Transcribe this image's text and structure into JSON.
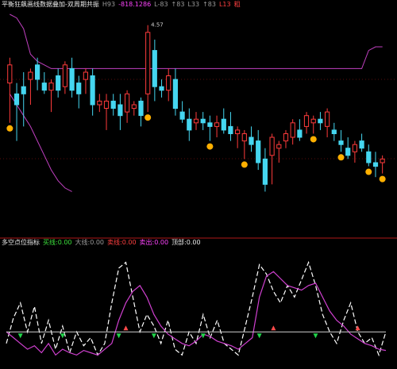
{
  "colors": {
    "background": "#000000",
    "up_candle": "#ff3b3b",
    "down_candle": "#45d6f0",
    "band": "#c040c0",
    "signal_marker": "#ffb000",
    "grid": "#b01818",
    "indicator_fast": "#ffffff",
    "indicator_slow": "#d040d0",
    "zero_line": "#d0d0d0",
    "buy_arrow": "#21d44a",
    "sell_arrow": "#ff4a4a"
  },
  "header": {
    "title": "平衡狂飙画线数据叠加-双周期共振",
    "items": [
      {
        "text": "H93",
        "color": "gray"
      },
      {
        "text": "-818.1286",
        "color": "mag"
      },
      {
        "text": "L-83",
        "color": "gray"
      },
      {
        "text": "↑83",
        "color": "gray"
      },
      {
        "text": "L33",
        "color": "gray"
      },
      {
        "text": "↑83",
        "color": "gray"
      },
      {
        "text": "L13",
        "color": "red"
      },
      {
        "text": "粗",
        "color": "red"
      }
    ]
  },
  "indicator_header": {
    "title": "多空点位指标",
    "items": [
      {
        "text": "买线:0.00",
        "color": "green"
      },
      {
        "text": "大线:0.00",
        "color": "gray"
      },
      {
        "text": "卖线:0.00",
        "color": "red"
      },
      {
        "text": "卖出:0.00",
        "color": "mag"
      },
      {
        "text": "顶部:0.00",
        "color": "white"
      }
    ]
  },
  "price_annotation": "4.57",
  "chart_data": [
    {
      "type": "candlestick",
      "title": "平衡狂飙画线数据叠加-双周期共振",
      "ylim": [
        0,
        100
      ],
      "candles": [
        {
          "o": 62,
          "h": 76,
          "l": 40,
          "c": 72
        },
        {
          "o": 56,
          "h": 62,
          "l": 30,
          "c": 50
        },
        {
          "o": 60,
          "h": 68,
          "l": 38,
          "c": 56
        },
        {
          "o": 64,
          "h": 70,
          "l": 50,
          "c": 68
        },
        {
          "o": 72,
          "h": 76,
          "l": 58,
          "c": 64
        },
        {
          "o": 62,
          "h": 68,
          "l": 56,
          "c": 58
        },
        {
          "o": 58,
          "h": 64,
          "l": 46,
          "c": 62
        },
        {
          "o": 66,
          "h": 70,
          "l": 54,
          "c": 58
        },
        {
          "o": 60,
          "h": 74,
          "l": 56,
          "c": 72
        },
        {
          "o": 70,
          "h": 76,
          "l": 54,
          "c": 58
        },
        {
          "o": 62,
          "h": 66,
          "l": 48,
          "c": 56
        },
        {
          "o": 64,
          "h": 70,
          "l": 56,
          "c": 68
        },
        {
          "o": 66,
          "h": 70,
          "l": 44,
          "c": 50
        },
        {
          "o": 50,
          "h": 56,
          "l": 46,
          "c": 52
        },
        {
          "o": 48,
          "h": 56,
          "l": 36,
          "c": 52
        },
        {
          "o": 52,
          "h": 56,
          "l": 44,
          "c": 48
        },
        {
          "o": 50,
          "h": 56,
          "l": 36,
          "c": 44
        },
        {
          "o": 46,
          "h": 58,
          "l": 40,
          "c": 56
        },
        {
          "o": 48,
          "h": 52,
          "l": 44,
          "c": 50
        },
        {
          "o": 52,
          "h": 54,
          "l": 38,
          "c": 44
        },
        {
          "o": 56,
          "h": 94,
          "l": 46,
          "c": 90
        },
        {
          "o": 80,
          "h": 86,
          "l": 52,
          "c": 60
        },
        {
          "o": 60,
          "h": 64,
          "l": 54,
          "c": 58
        },
        {
          "o": 58,
          "h": 70,
          "l": 52,
          "c": 66
        },
        {
          "o": 64,
          "h": 70,
          "l": 44,
          "c": 48
        },
        {
          "o": 46,
          "h": 52,
          "l": 40,
          "c": 42
        },
        {
          "o": 42,
          "h": 48,
          "l": 30,
          "c": 36
        },
        {
          "o": 40,
          "h": 46,
          "l": 36,
          "c": 42
        },
        {
          "o": 42,
          "h": 46,
          "l": 36,
          "c": 40
        },
        {
          "o": 40,
          "h": 44,
          "l": 30,
          "c": 38
        },
        {
          "o": 38,
          "h": 44,
          "l": 32,
          "c": 40
        },
        {
          "o": 42,
          "h": 48,
          "l": 34,
          "c": 36
        },
        {
          "o": 38,
          "h": 46,
          "l": 30,
          "c": 34
        },
        {
          "o": 34,
          "h": 38,
          "l": 26,
          "c": 36
        },
        {
          "o": 30,
          "h": 36,
          "l": 20,
          "c": 34
        },
        {
          "o": 32,
          "h": 38,
          "l": 24,
          "c": 28
        },
        {
          "o": 30,
          "h": 36,
          "l": 14,
          "c": 18
        },
        {
          "o": 20,
          "h": 26,
          "l": 2,
          "c": 6
        },
        {
          "o": 22,
          "h": 34,
          "l": 6,
          "c": 32
        },
        {
          "o": 26,
          "h": 30,
          "l": 18,
          "c": 28
        },
        {
          "o": 30,
          "h": 36,
          "l": 26,
          "c": 34
        },
        {
          "o": 32,
          "h": 42,
          "l": 28,
          "c": 40
        },
        {
          "o": 36,
          "h": 42,
          "l": 30,
          "c": 32
        },
        {
          "o": 38,
          "h": 46,
          "l": 34,
          "c": 44
        },
        {
          "o": 40,
          "h": 44,
          "l": 34,
          "c": 42
        },
        {
          "o": 42,
          "h": 46,
          "l": 36,
          "c": 40
        },
        {
          "o": 38,
          "h": 48,
          "l": 32,
          "c": 46
        },
        {
          "o": 36,
          "h": 40,
          "l": 30,
          "c": 34
        },
        {
          "o": 30,
          "h": 36,
          "l": 24,
          "c": 28
        },
        {
          "o": 26,
          "h": 32,
          "l": 20,
          "c": 22
        },
        {
          "o": 24,
          "h": 30,
          "l": 18,
          "c": 28
        },
        {
          "o": 30,
          "h": 34,
          "l": 24,
          "c": 26
        },
        {
          "o": 24,
          "h": 28,
          "l": 16,
          "c": 18
        },
        {
          "o": 18,
          "h": 24,
          "l": 10,
          "c": 16
        },
        {
          "o": 18,
          "h": 22,
          "l": 12,
          "c": 20
        }
      ],
      "upper_band": [
        100,
        98,
        92,
        78,
        74,
        72,
        70,
        70,
        70,
        70,
        70,
        70,
        70,
        70,
        70,
        70,
        70,
        70,
        70,
        70,
        70,
        70,
        70,
        70,
        70,
        70,
        70,
        70,
        70,
        70,
        70,
        70,
        70,
        70,
        70,
        70,
        70,
        70,
        70,
        70,
        70,
        70,
        70,
        70,
        70,
        70,
        70,
        70,
        70,
        70,
        70,
        70,
        80,
        82,
        82
      ],
      "lower_band": [
        56,
        50,
        44,
        38,
        30,
        22,
        14,
        8,
        4,
        2,
        null,
        null,
        null,
        null,
        null,
        null,
        null,
        null,
        null,
        null,
        null,
        null,
        null,
        null,
        null,
        null,
        null,
        null,
        null,
        null,
        null,
        null,
        null,
        null,
        null,
        null,
        null,
        null,
        null,
        null,
        null,
        null,
        null,
        null,
        null,
        null,
        null,
        null,
        null,
        null,
        null,
        null,
        null,
        null,
        null
      ],
      "signal_markers": [
        0,
        20,
        29,
        34,
        44,
        48,
        52,
        54
      ]
    },
    {
      "type": "line",
      "title": "多空点位指标",
      "ylim": [
        0,
        100
      ],
      "series": [
        {
          "name": "买线",
          "values": [
            20,
            42,
            55,
            30,
            52,
            20,
            40,
            15,
            35,
            12,
            30,
            18,
            25,
            10,
            20,
            55,
            85,
            90,
            60,
            30,
            45,
            35,
            20,
            40,
            15,
            10,
            30,
            20,
            45,
            25,
            40,
            20,
            15,
            10,
            35,
            60,
            88,
            80,
            65,
            55,
            70,
            60,
            75,
            90,
            70,
            45,
            30,
            20,
            40,
            55,
            30,
            20,
            25,
            10,
            30
          ]
        },
        {
          "name": "卖线",
          "values": [
            30,
            25,
            20,
            15,
            18,
            12,
            20,
            10,
            15,
            12,
            10,
            14,
            12,
            10,
            15,
            20,
            40,
            55,
            65,
            70,
            60,
            45,
            35,
            28,
            24,
            20,
            18,
            22,
            28,
            26,
            22,
            20,
            18,
            15,
            20,
            25,
            60,
            78,
            82,
            76,
            70,
            68,
            66,
            70,
            72,
            60,
            48,
            40,
            35,
            28,
            24,
            20,
            18,
            15,
            14
          ]
        },
        {
          "name": "零轴",
          "values": [
            30,
            30,
            30,
            30,
            30,
            30,
            30,
            30,
            30,
            30,
            30,
            30,
            30,
            30,
            30,
            30,
            30,
            30,
            30,
            30,
            30,
            30,
            30,
            30,
            30,
            30,
            30,
            30,
            30,
            30,
            30,
            30,
            30,
            30,
            30,
            30,
            30,
            30,
            30,
            30,
            30,
            30,
            30,
            30,
            30,
            30,
            30,
            30,
            30,
            30,
            30,
            30,
            30,
            30,
            30
          ]
        }
      ],
      "buy_signals": [
        2,
        8,
        16,
        21,
        28,
        36,
        44
      ],
      "sell_signals": [
        17,
        38,
        50
      ]
    }
  ]
}
